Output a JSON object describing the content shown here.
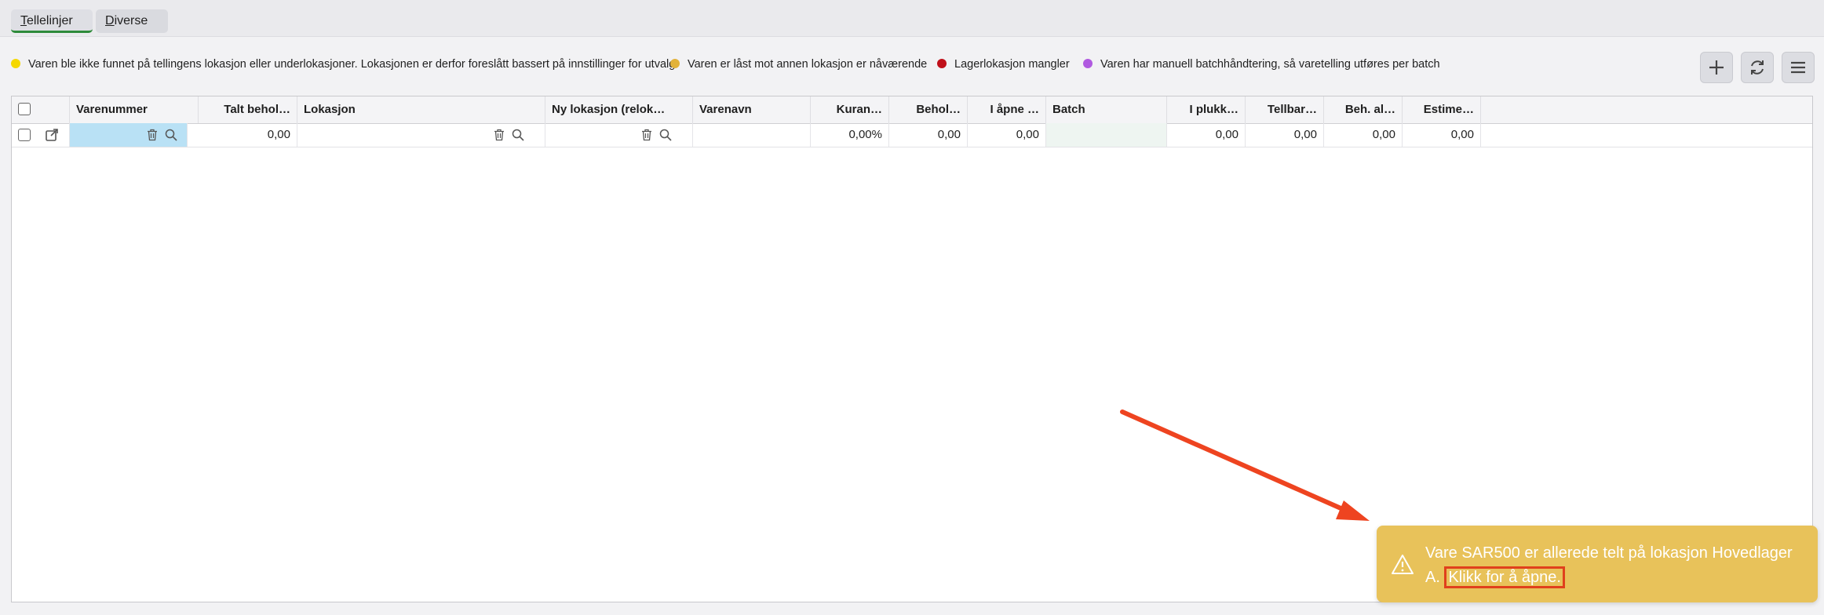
{
  "tabs": [
    {
      "label_first": "T",
      "label_rest": "ellelinjer",
      "active": true
    },
    {
      "label_first": "D",
      "label_rest": "iverse",
      "active": false
    }
  ],
  "legend": [
    {
      "color": "#f5d800",
      "text": "Varen ble ikke funnet på tellingens lokasjon eller underlokasjoner. Lokasjonen er derfor foreslått bassert på innstillinger for utvalg"
    },
    {
      "color": "#e2b23a",
      "text": "Varen er låst mot annen lokasjon er nåværende"
    },
    {
      "color": "#c0101a",
      "text": "Lagerlokasjon mangler"
    },
    {
      "color": "#b05ae0",
      "text": "Varen har manuell batchhåndtering, så varetelling utføres per batch"
    }
  ],
  "toolbar": {
    "add_icon": "plus-icon",
    "refresh_icon": "refresh-icon",
    "menu_icon": "hamburger-menu-icon"
  },
  "grid": {
    "columns": [
      "Varenummer",
      "Talt behol…",
      "Lokasjon",
      "Ny lokasjon (relok…",
      "Varenavn",
      "Kuran…",
      "Behol…",
      "I åpne …",
      "Batch",
      "I plukk…",
      "Tellbar…",
      "Beh. al…",
      "Estime…"
    ],
    "row": {
      "varenummer": "",
      "talt": "0,00",
      "lokasjon": "",
      "ny_lokasjon": "",
      "varenavn": "",
      "kurans": "0,00%",
      "behold": "0,00",
      "i_apne": "0,00",
      "batch": "",
      "i_plukk": "0,00",
      "tellbar": "0,00",
      "beh_al": "0,00",
      "estime": "0,00"
    }
  },
  "toast": {
    "message": "Vare SAR500 er allerede telt på lokasjon Hovedlager A.",
    "link": "Klikk for å åpne."
  }
}
